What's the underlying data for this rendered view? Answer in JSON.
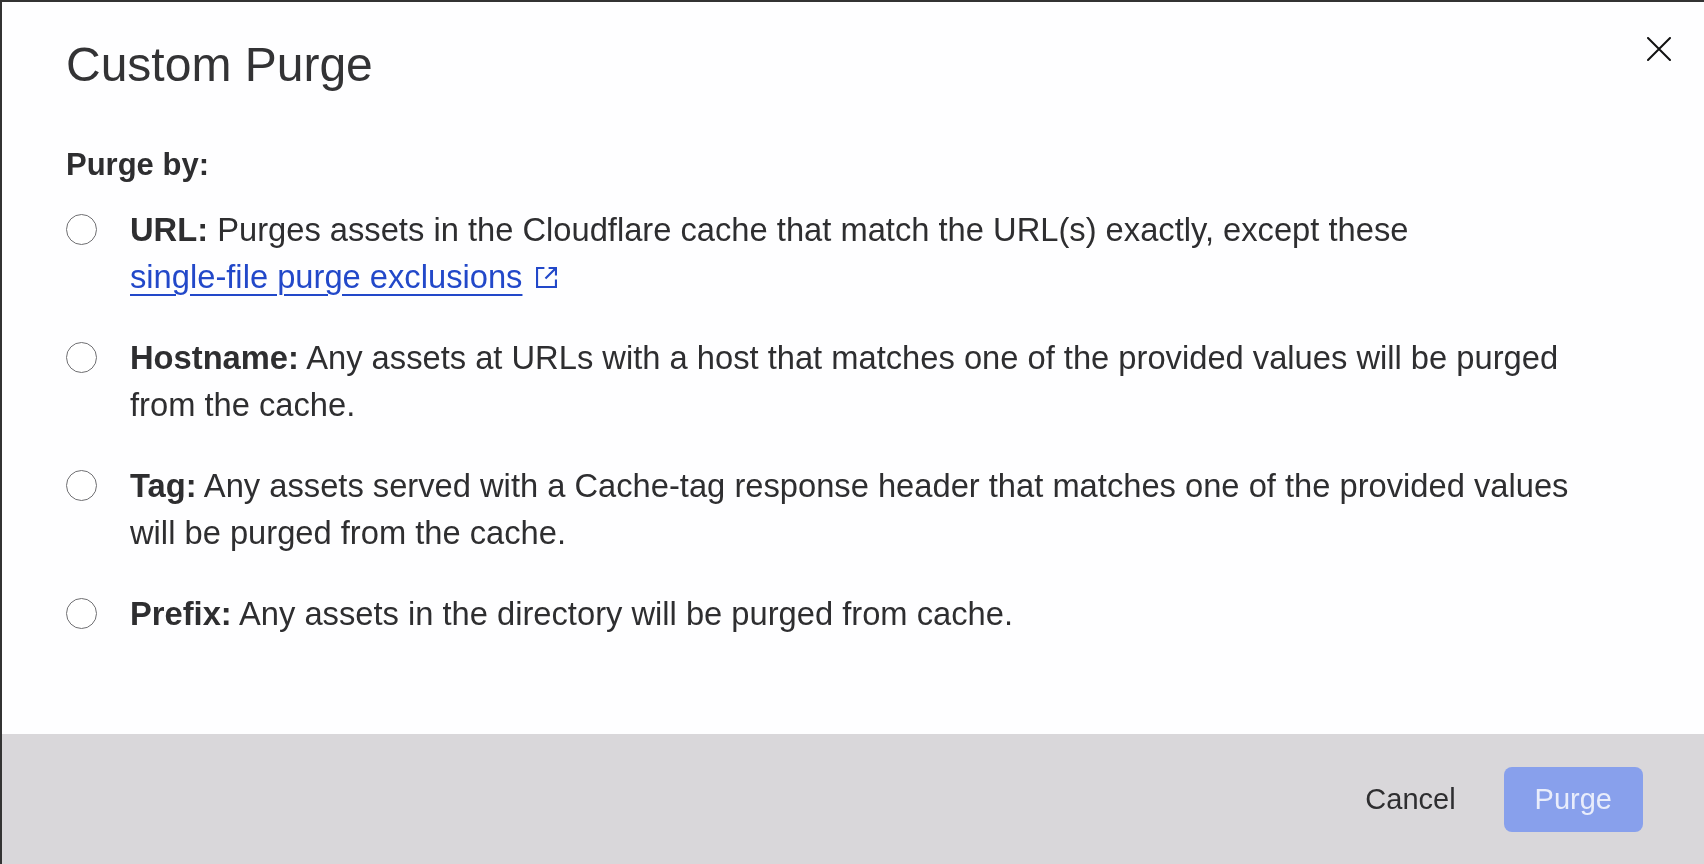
{
  "dialog": {
    "title": "Custom Purge",
    "section_label": "Purge by:",
    "options": [
      {
        "label": "URL:",
        "description": "Purges assets in the Cloudflare cache that match the URL(s) exactly, except these",
        "link": "single-file purge exclusions",
        "selected": false
      },
      {
        "label": "Hostname:",
        "description": "Any assets at URLs with a host that matches one of the provided values will be purged from the cache.",
        "selected": false
      },
      {
        "label": "Tag:",
        "description": "Any assets served with a Cache-tag response header that matches one of the provided values will be purged from the cache.",
        "selected": false
      },
      {
        "label": "Prefix:",
        "description": "Any assets in the directory will be purged from cache.",
        "selected": false
      }
    ],
    "buttons": [
      {
        "label": "Cancel",
        "kind": "secondary",
        "disabled": false
      },
      {
        "label": "Purge",
        "kind": "primary",
        "disabled": true
      }
    ]
  }
}
